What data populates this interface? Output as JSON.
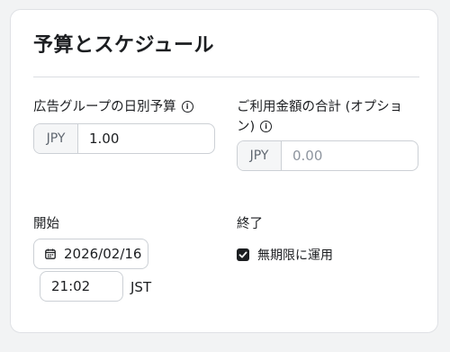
{
  "section": {
    "title": "予算とスケジュール"
  },
  "budget": {
    "label": "広告グループの日別予算",
    "currency": "JPY",
    "value": "1.00"
  },
  "total_cap": {
    "label_line1": "ご利用金額の合計 (オプショ",
    "label_line2": "ン)",
    "currency": "JPY",
    "placeholder": "0.00"
  },
  "start": {
    "label": "開始",
    "date": "2026/02/16",
    "time": "21:02",
    "timezone": "JST"
  },
  "end": {
    "label": "終了",
    "checkbox_label": "無期限に運用",
    "checked": true
  },
  "icons": {
    "info": "info-icon",
    "calendar": "calendar-icon",
    "check": "checkmark-icon"
  }
}
